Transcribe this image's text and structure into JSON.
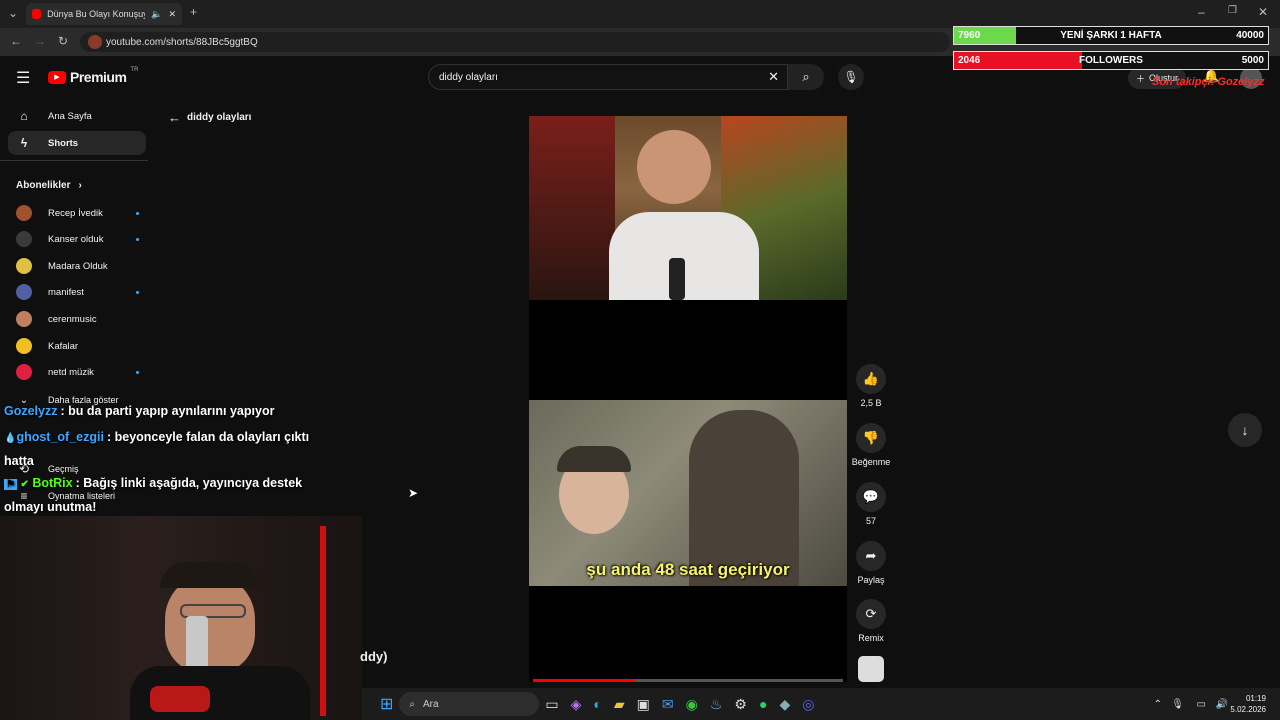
{
  "browser": {
    "tab_title": "Dünya Bu Olayı Konuşuyor!",
    "url": "youtube.com/shorts/88JBc5ggtBQ"
  },
  "header": {
    "logo_text": "Premium",
    "region": "TR",
    "search_value": "diddy olayları",
    "create_label": "Oluştur"
  },
  "sidebar": {
    "home": "Ana Sayfa",
    "shorts": "Shorts",
    "subs_title": "Abonelikler",
    "subscriptions": [
      {
        "name": "Recep İvedik",
        "color": "#a0522d"
      },
      {
        "name": "Kanser olduk",
        "color": "#3a3a3a"
      },
      {
        "name": "Madara Olduk",
        "color": "#e0c040"
      },
      {
        "name": "manifest",
        "color": "#5060a0"
      },
      {
        "name": "cerenmusic",
        "color": "#c08060"
      },
      {
        "name": "Kafalar",
        "color": "#f0c020"
      },
      {
        "name": "netd müzik",
        "color": "#e02040"
      }
    ],
    "show_more": "Daha fazla göster",
    "history": "Geçmiş",
    "playlists": "Oynatma listeleri"
  },
  "back_label": "diddy olayları",
  "video": {
    "subtitle": "şu anda 48 saat geçiriyor",
    "progress_fraction": 0.33
  },
  "actions": {
    "likes": "2,5 B",
    "dislike": "Beğenme",
    "comments": "57",
    "share": "Paylaş",
    "remix": "Remix"
  },
  "overlays": {
    "counter1": {
      "current": "7960",
      "label": "YENİ ŞARKI 1 HAFTA",
      "goal": "40000",
      "fraction": 0.199,
      "color": "#6cd94a"
    },
    "counter2": {
      "current": "2046",
      "label": "FOLLOWERS",
      "goal": "5000",
      "fraction": 0.409,
      "color": "#e81123"
    },
    "last_follower": "Son takipçi: Gozelyzz"
  },
  "chat": [
    {
      "user": "Gozelyzz",
      "user_color": "#3ea6ff",
      "text": ": bu da parti yapıp aynılarını yapıyor"
    },
    {
      "user": "ghost_of_ezgii",
      "user_color": "#3ea6ff",
      "text": ": beyonceyle falan da olayları çıktı hatta"
    },
    {
      "user": "BotRix",
      "user_color": "#53fc18",
      "text": ": Bağış linki aşağıda, yayıncıya destek olmayı unutma!"
    }
  ],
  "partial_title": "ddy)",
  "taskbar": {
    "search": "Ara",
    "time": "01:19",
    "date": "5.02.2026"
  }
}
